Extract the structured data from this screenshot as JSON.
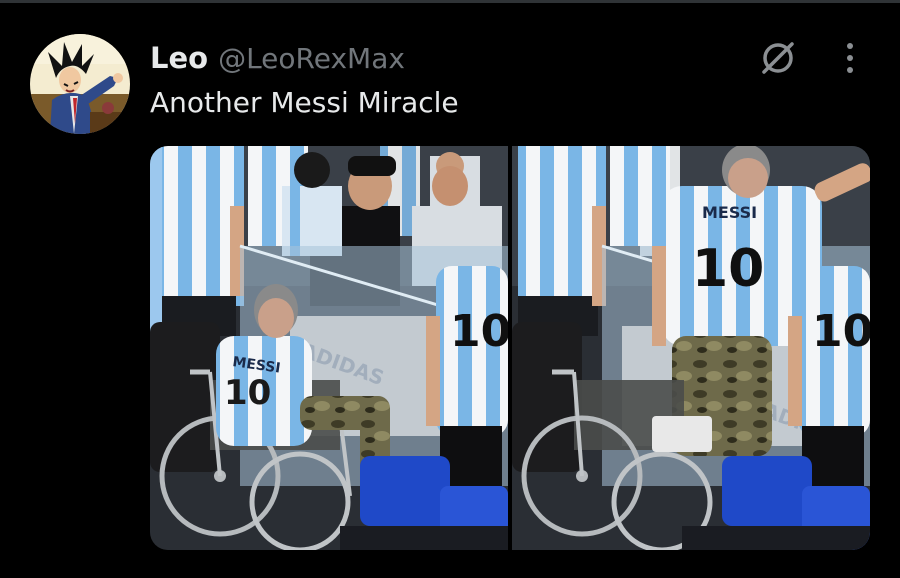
{
  "tweet": {
    "display_name": "Leo",
    "handle": "@LeoRexMax",
    "text": "Another Messi Miracle"
  },
  "icons": {
    "grok": "grok-slash-circle-icon",
    "more": "more-vertical-icon",
    "avatar": "anime-avatar-icon"
  },
  "media": {
    "count": 2,
    "left_photo": {
      "jersey_name": "MESSI",
      "jersey_number": "10",
      "banner_text": "ADIDAS"
    },
    "right_photo": {
      "jersey_name": "MESSI",
      "jersey_number": "10",
      "banner_text": "ADIDAS"
    }
  },
  "colors": {
    "background": "#000000",
    "text_primary": "#e7e9ea",
    "text_secondary": "#71767b",
    "albiceleste_blue": "#6cace4"
  }
}
